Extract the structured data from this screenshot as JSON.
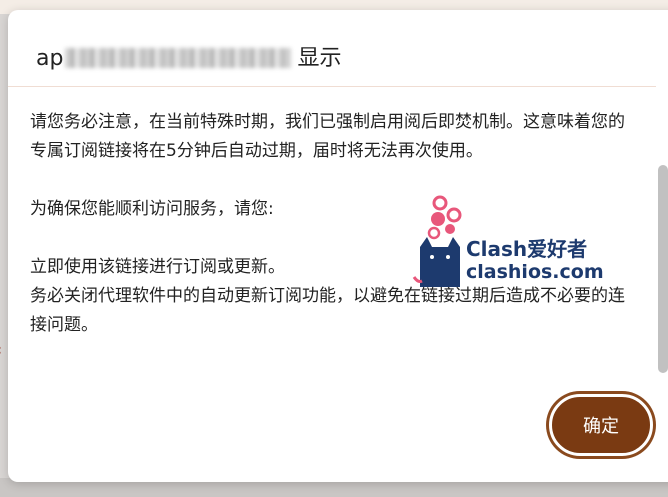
{
  "dialog": {
    "title_prefix": "ap",
    "title_suffix": "显示",
    "paragraph1": "请您务必注意，在当前特殊时期，我们已强制启用阅后即焚机制。这意味着您的专属订阅链接将在5分钟后自动过期，届时将无法再次使用。",
    "paragraph2": "为确保您能顺利访问服务，请您:",
    "item1": "立即使用该链接进行订阅或更新。",
    "item2": "务必关闭代理软件中的自动更新订阅功能，以避免在链接过期后造成不必要的连接问题。",
    "confirm_label": "确定"
  },
  "watermark": {
    "line1": "Clash爱好者",
    "line2": "clashios.com"
  },
  "colors": {
    "confirm_button": "#7a3a12",
    "watermark_text": "#1d3a6e",
    "heart_pink": "#e8577b"
  }
}
